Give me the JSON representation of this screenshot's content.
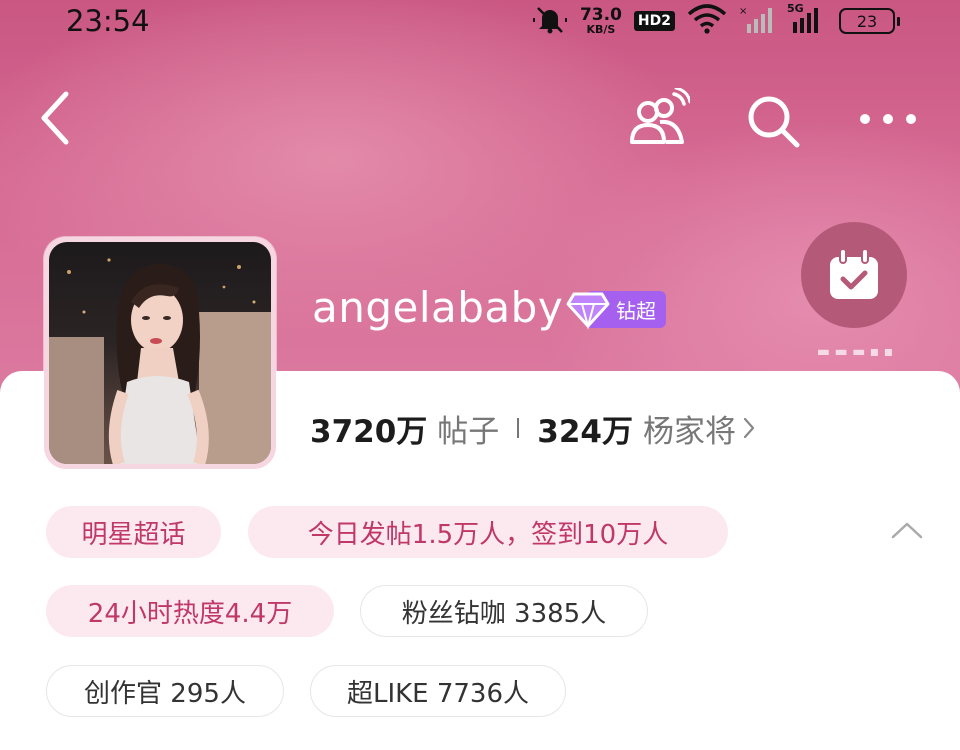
{
  "status_bar": {
    "time": "23:54",
    "net_speed_value": "73.0",
    "net_speed_unit": "KB/S",
    "hd_label": "HD2",
    "signal_label": "5G",
    "battery": "23"
  },
  "nav": {
    "back_icon": "chevron-left-icon",
    "chat_icon": "group-chat-icon",
    "search_icon": "search-icon",
    "more_icon": "more-icon"
  },
  "profile": {
    "username": "angelababy",
    "badge_label": "钻超",
    "checkin_icon": "calendar-check-icon"
  },
  "stats": {
    "posts_count": "3720万",
    "posts_label": "帖子",
    "fans_count": "324万",
    "fans_label": "杨家将"
  },
  "tags": [
    {
      "label": "明星超话"
    },
    {
      "label": "今日发帖1.5万人，签到10万人"
    },
    {
      "label": "24小时热度4.4万"
    },
    {
      "label": "粉丝钻咖 3385人"
    },
    {
      "label": "创作官 295人"
    },
    {
      "label": "超LIKE 7736人"
    }
  ],
  "colors": {
    "header_pink": "#d66a93",
    "tag_pink_bg": "#fce9ef",
    "tag_pink_text": "#c03868",
    "badge_purple": "#a560f0"
  }
}
